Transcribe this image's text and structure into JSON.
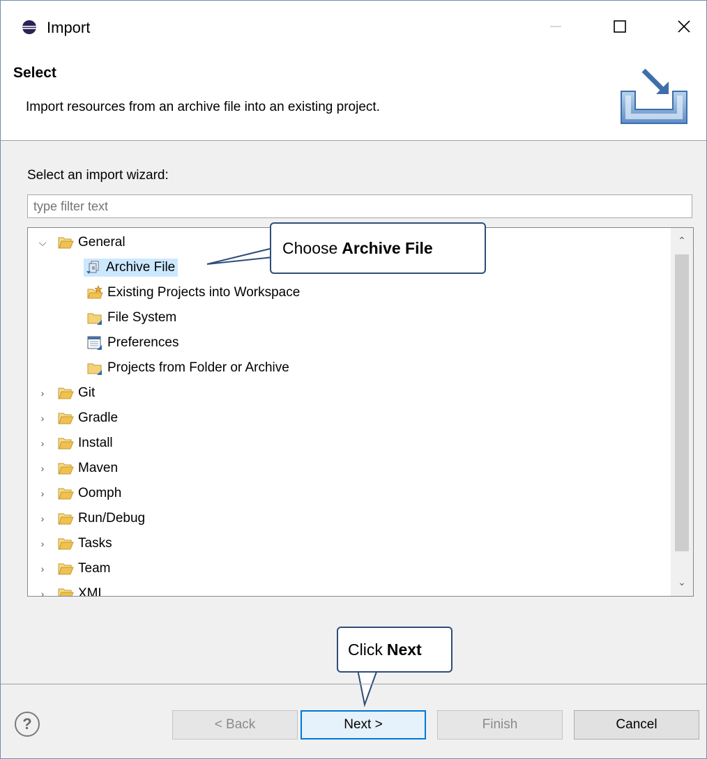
{
  "window": {
    "title": "Import",
    "controls": {
      "minimize": "—",
      "maximize": "☐",
      "close": "✕"
    }
  },
  "banner": {
    "title": "Select",
    "description": "Import resources from an archive file into an existing project."
  },
  "wizard": {
    "prompt": "Select an import wizard:",
    "filter_placeholder": "type filter text"
  },
  "tree": {
    "items": [
      {
        "label": "General",
        "expanded": true,
        "icon": "folder-open-icon"
      },
      {
        "label": "Archive File",
        "icon": "archive-file-icon",
        "selected": true
      },
      {
        "label": "Existing Projects into Workspace",
        "icon": "existing-projects-icon"
      },
      {
        "label": "File System",
        "icon": "folder-import-icon"
      },
      {
        "label": "Preferences",
        "icon": "preferences-icon"
      },
      {
        "label": "Projects from Folder or Archive",
        "icon": "folder-import-icon"
      },
      {
        "label": "Git",
        "expanded": false,
        "icon": "folder-open-icon"
      },
      {
        "label": "Gradle",
        "expanded": false,
        "icon": "folder-open-icon"
      },
      {
        "label": "Install",
        "expanded": false,
        "icon": "folder-open-icon"
      },
      {
        "label": "Maven",
        "expanded": false,
        "icon": "folder-open-icon"
      },
      {
        "label": "Oomph",
        "expanded": false,
        "icon": "folder-open-icon"
      },
      {
        "label": "Run/Debug",
        "expanded": false,
        "icon": "folder-open-icon"
      },
      {
        "label": "Tasks",
        "expanded": false,
        "icon": "folder-open-icon"
      },
      {
        "label": "Team",
        "expanded": false,
        "icon": "folder-open-icon"
      },
      {
        "label": "XML",
        "expanded": false,
        "icon": "folder-open-icon"
      }
    ]
  },
  "buttons": {
    "help": "?",
    "back": "< Back",
    "next": "Next >",
    "finish": "Finish",
    "cancel": "Cancel"
  },
  "callouts": {
    "choose_prefix": "Choose",
    "choose_bold": "Archive File",
    "click_prefix": "Click",
    "click_bold": "Next"
  },
  "colors": {
    "selection": "#cce8ff",
    "callout_border": "#2e4d78",
    "default_button_border": "#0078d7",
    "folder": "#f0c050"
  }
}
